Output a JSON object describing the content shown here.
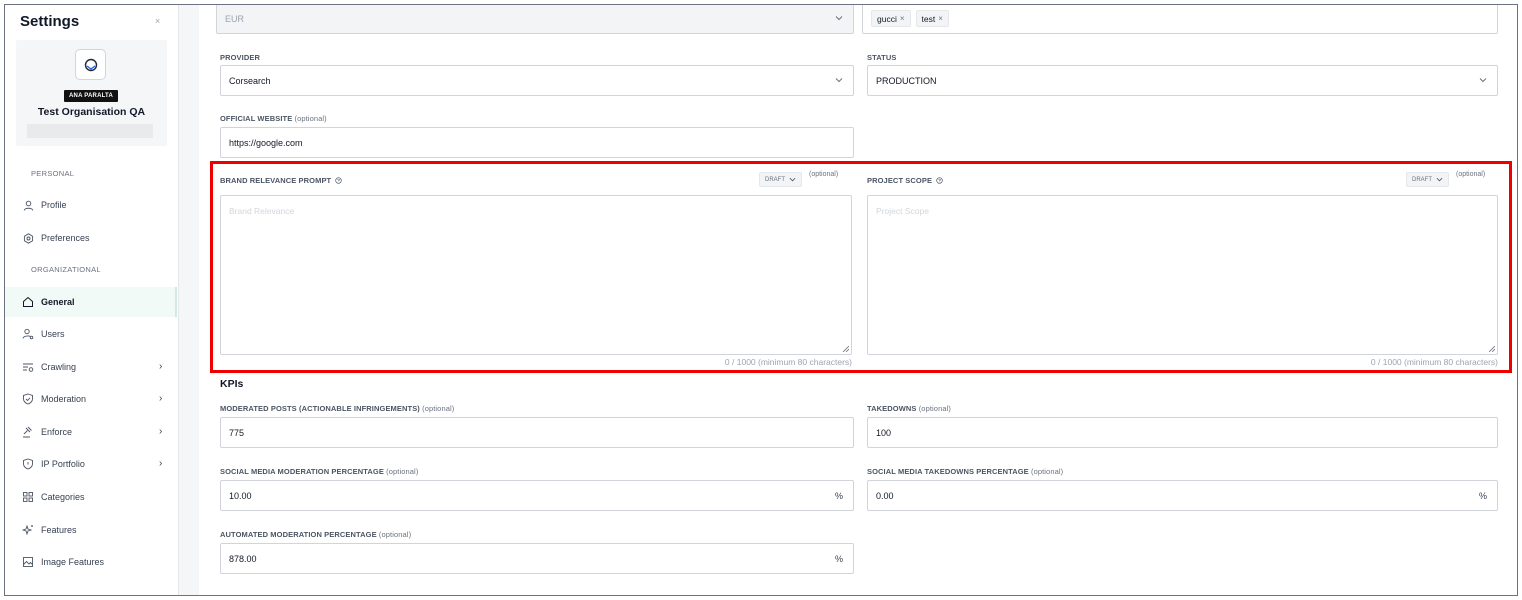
{
  "sidebar": {
    "title": "Settings",
    "close_icon": "×",
    "org": {
      "badge": "ANA PARALTA",
      "name": "Test Organisation QA"
    },
    "sections": {
      "personal": "PERSONAL",
      "organizational": "ORGANIZATIONAL"
    },
    "items": [
      {
        "label": "Profile",
        "icon": "user-icon"
      },
      {
        "label": "Preferences",
        "icon": "gear-icon"
      },
      {
        "label": "General",
        "icon": "home-icon",
        "active": true
      },
      {
        "label": "Users",
        "icon": "users-icon"
      },
      {
        "label": "Crawling",
        "icon": "crawl-icon",
        "chevron": "›"
      },
      {
        "label": "Moderation",
        "icon": "shield-check-icon",
        "chevron": "›"
      },
      {
        "label": "Enforce",
        "icon": "gavel-icon",
        "chevron": "›"
      },
      {
        "label": "IP Portfolio",
        "icon": "shield-icon",
        "chevron": "›"
      },
      {
        "label": "Categories",
        "icon": "grid-icon"
      },
      {
        "label": "Features",
        "icon": "sparkle-icon"
      },
      {
        "label": "Image Features",
        "icon": "image-icon"
      }
    ]
  },
  "form": {
    "currency": {
      "value": "EUR"
    },
    "tags": [
      {
        "label": "gucci"
      },
      {
        "label": "test"
      }
    ],
    "provider": {
      "label": "PROVIDER",
      "value": "Corsearch"
    },
    "status": {
      "label": "STATUS",
      "value": "PRODUCTION"
    },
    "website": {
      "label": "OFFICIAL WEBSITE",
      "optional": "(optional)",
      "value": "https://google.com"
    },
    "brand_relevance": {
      "label": "BRAND RELEVANCE PROMPT",
      "draft": "DRAFT",
      "optional": "(optional)",
      "placeholder": "Brand Relevance",
      "counter": "0 / 1000 (minimum 80 characters)"
    },
    "project_scope": {
      "label": "PROJECT SCOPE",
      "draft": "DRAFT",
      "optional": "(optional)",
      "placeholder": "Project Scope",
      "counter": "0 / 1000 (minimum 80 characters)"
    },
    "kpis_title": "KPIs",
    "moderated_posts": {
      "label": "MODERATED POSTS (ACTIONABLE INFRINGEMENTS)",
      "optional": "(optional)",
      "value": "775"
    },
    "takedowns": {
      "label": "TAKEDOWNS",
      "optional": "(optional)",
      "value": "100"
    },
    "social_moderation_pct": {
      "label": "SOCIAL MEDIA MODERATION PERCENTAGE",
      "optional": "(optional)",
      "value": "10.00",
      "unit": "%"
    },
    "social_takedowns_pct": {
      "label": "SOCIAL MEDIA TAKEDOWNS PERCENTAGE",
      "optional": "(optional)",
      "value": "0.00",
      "unit": "%"
    },
    "automated_moderation_pct": {
      "label": "AUTOMATED MODERATION PERCENTAGE",
      "optional": "(optional)",
      "value": "878.00",
      "unit": "%"
    }
  },
  "colors": {
    "highlight": "#ee0000",
    "active_bg": "#f1faf6"
  }
}
